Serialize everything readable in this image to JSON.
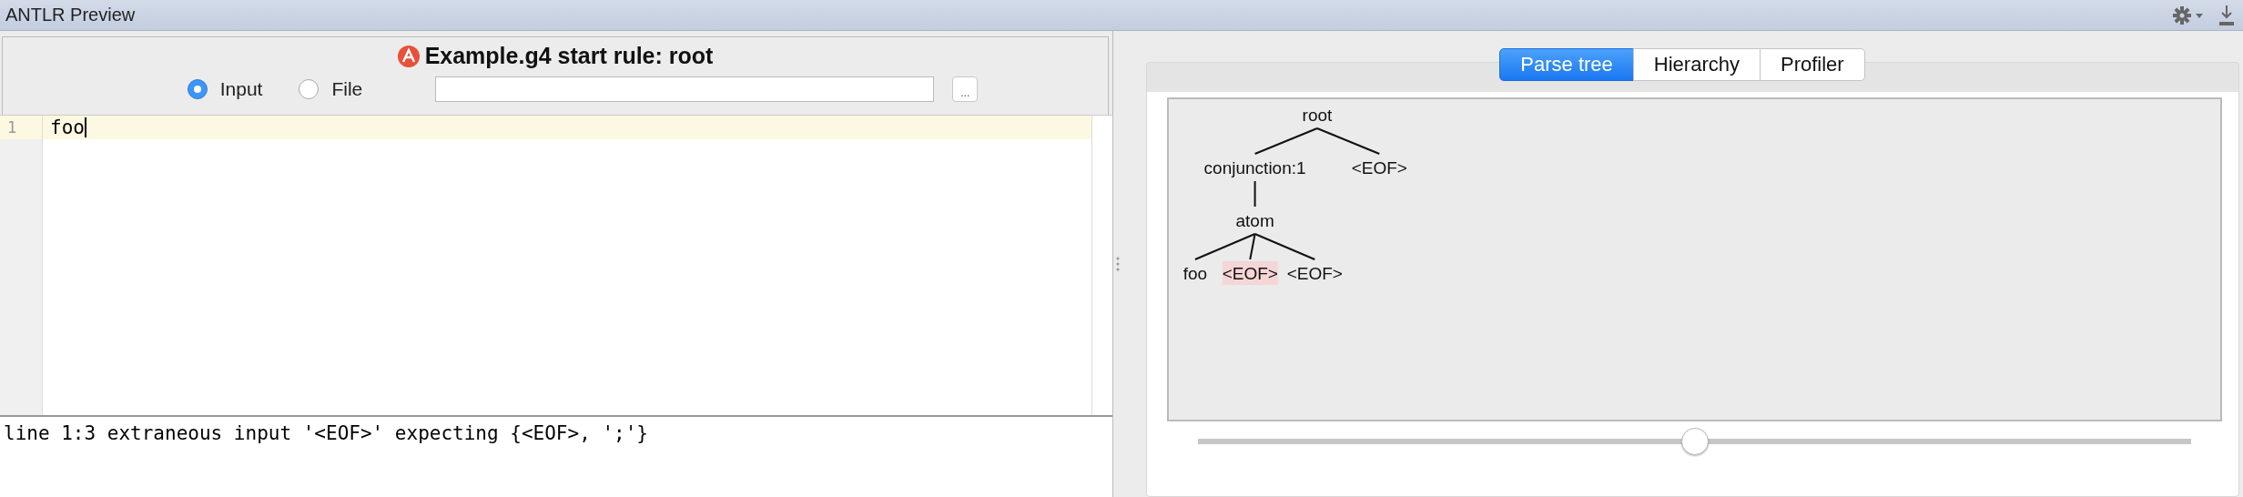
{
  "window": {
    "title": "ANTLR Preview"
  },
  "header": {
    "title": "Example.g4 start rule: root"
  },
  "source": [
    {
      "label": "Input",
      "selected": true
    },
    {
      "label": "File",
      "selected": false
    }
  ],
  "browse_button": {
    "label": "..."
  },
  "editor": {
    "lines": [
      {
        "number": "1",
        "text": "foo",
        "current": true
      }
    ]
  },
  "console": {
    "text": "line 1:3 extraneous input '<EOF>' expecting {<EOF>, ';'}"
  },
  "tabs": [
    {
      "label": "Parse tree",
      "selected": true
    },
    {
      "label": "Hierarchy",
      "selected": false
    },
    {
      "label": "Profiler",
      "selected": false
    }
  ],
  "parse_tree": {
    "label": "root",
    "error": false,
    "children": [
      {
        "label": "conjunction:1",
        "error": false,
        "children": [
          {
            "label": "atom",
            "error": false,
            "children": [
              {
                "label": "foo",
                "error": false
              },
              {
                "label": "<EOF>",
                "error": true
              },
              {
                "label": "<EOF>",
                "error": false
              }
            ]
          }
        ]
      },
      {
        "label": "<EOF>",
        "error": false
      }
    ]
  },
  "zoom_slider": {
    "level": 0.5
  }
}
